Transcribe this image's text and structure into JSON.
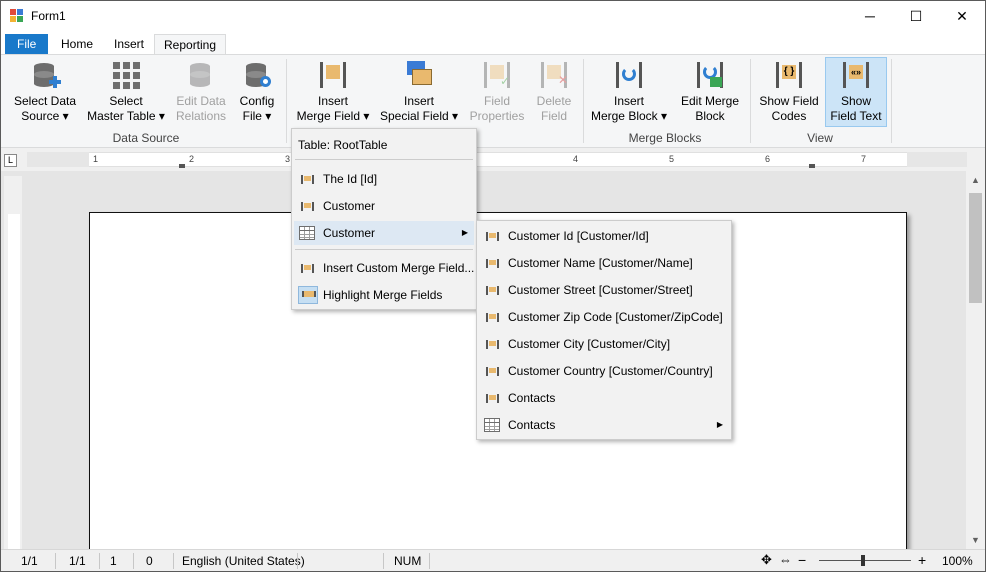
{
  "window": {
    "title": "Form1",
    "minimize": "─",
    "maximize": "☐",
    "close": "✕"
  },
  "tabs": {
    "file": "File",
    "home": "Home",
    "insert": "Insert",
    "reporting": "Reporting"
  },
  "ribbon": {
    "data_source": {
      "group_label": "Data Source",
      "select_data_source": [
        "Select Data",
        "Source ▾"
      ],
      "select_master_table": [
        "Select",
        "Master Table ▾"
      ],
      "edit_data_relations": [
        "Edit Data",
        "Relations"
      ],
      "config_file": [
        "Config",
        "File ▾"
      ]
    },
    "merge_fields": {
      "insert_merge_field": [
        "Insert",
        "Merge Field ▾"
      ],
      "insert_special_field": [
        "Insert",
        "Special Field ▾"
      ],
      "field_properties": [
        "Field",
        "Properties"
      ],
      "delete_field": [
        "Delete",
        "Field"
      ]
    },
    "merge_blocks": {
      "group_label": "Merge Blocks",
      "insert_merge_block": [
        "Insert",
        "Merge Block ▾"
      ],
      "edit_merge_block": [
        "Edit Merge",
        "Block"
      ]
    },
    "view": {
      "group_label": "View",
      "show_field_codes": [
        "Show Field",
        "Codes"
      ],
      "show_field_text": [
        "Show",
        "Field Text"
      ]
    }
  },
  "ruler": {
    "numbers": [
      "1",
      "2",
      "3",
      "4",
      "5",
      "6",
      "7"
    ],
    "corner": "L"
  },
  "merge_field_menu": {
    "header": "Table: RootTable",
    "items": [
      {
        "label": "The Id [Id]",
        "icon": "merge-field-icon"
      },
      {
        "label": "Customer",
        "icon": "merge-field-icon"
      },
      {
        "label": "Customer",
        "icon": "table-icon",
        "submenu": true
      },
      {
        "label": "Insert Custom Merge Field...",
        "icon": "merge-field-icon"
      },
      {
        "label": "Highlight Merge Fields",
        "icon": "highlight-icon"
      }
    ]
  },
  "customer_submenu": {
    "items": [
      {
        "label": "Customer Id [Customer/Id]",
        "icon": "merge-field-icon"
      },
      {
        "label": "Customer Name [Customer/Name]",
        "icon": "merge-field-icon"
      },
      {
        "label": "Customer Street [Customer/Street]",
        "icon": "merge-field-icon"
      },
      {
        "label": "Customer Zip Code [Customer/ZipCode]",
        "icon": "merge-field-icon"
      },
      {
        "label": "Customer City [Customer/City]",
        "icon": "merge-field-icon"
      },
      {
        "label": "Customer Country [Customer/Country]",
        "icon": "merge-field-icon"
      },
      {
        "label": "Contacts",
        "icon": "merge-field-icon"
      },
      {
        "label": "Contacts",
        "icon": "table-icon",
        "submenu": true
      }
    ]
  },
  "statusbar": {
    "page": "1/1",
    "section": "1/1",
    "line": "1",
    "column": "0",
    "language": "English (United States)",
    "num": "NUM",
    "zoom_minus": "−",
    "zoom_plus": "+",
    "zoom": "100%"
  },
  "colors": {
    "file_tab": "#1979ca",
    "pressed": "#cce4f7",
    "menu_hover": "#dde8f3",
    "field": "#e9b96e"
  }
}
